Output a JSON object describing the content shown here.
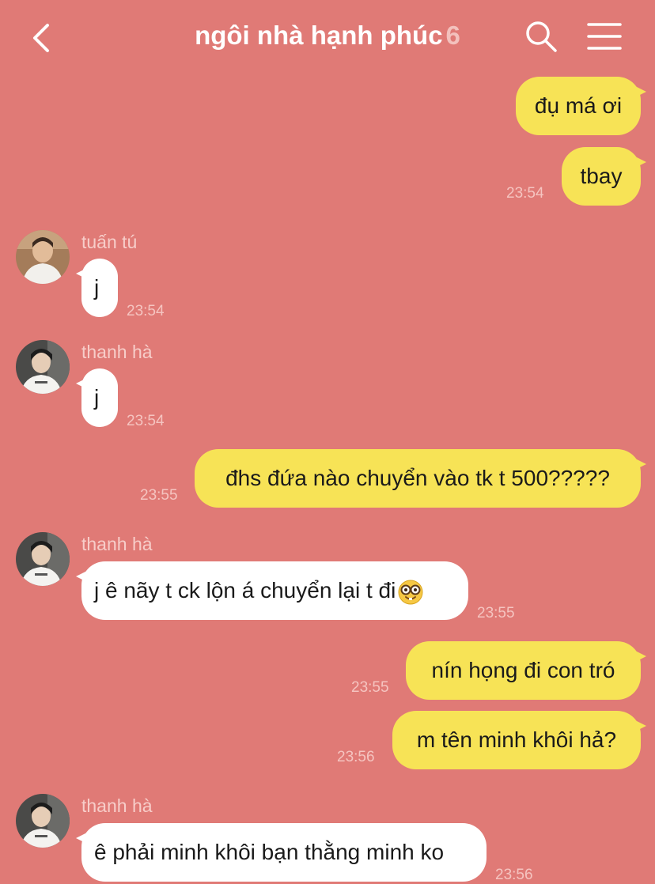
{
  "header": {
    "title": "ngôi nhà hạnh phúc",
    "member_count": "6",
    "back_icon": "chevron-left-icon",
    "search_icon": "search-icon",
    "menu_icon": "hamburger-menu-icon"
  },
  "colors": {
    "background": "#e07a76",
    "outgoing_bubble": "#f7e356",
    "incoming_bubble": "#ffffff"
  },
  "messages": [
    {
      "direction": "out",
      "text": "đụ má ơi"
    },
    {
      "direction": "out",
      "text": "tbay",
      "time": "23:54"
    },
    {
      "direction": "in",
      "sender": "tuấn tú",
      "text": "j",
      "time": "23:54"
    },
    {
      "direction": "in",
      "sender": "thanh hà",
      "text": "j",
      "time": "23:54"
    },
    {
      "direction": "out",
      "text": "đhs đứa nào chuyển vào tk t 500?????",
      "time": "23:55"
    },
    {
      "direction": "in",
      "sender": "thanh hà",
      "text": "j ê nãy t ck lộn á chuyển lại t đi",
      "emoji": "nerd-face-icon",
      "time": "23:55"
    },
    {
      "direction": "out",
      "text": "nín họng đi con tró",
      "time": "23:55"
    },
    {
      "direction": "out",
      "text": "m tên minh khôi hả?",
      "time": "23:56"
    },
    {
      "direction": "in",
      "sender": "thanh hà",
      "text": "ê phải minh khôi bạn thằng minh ko",
      "time": "23:56"
    }
  ]
}
